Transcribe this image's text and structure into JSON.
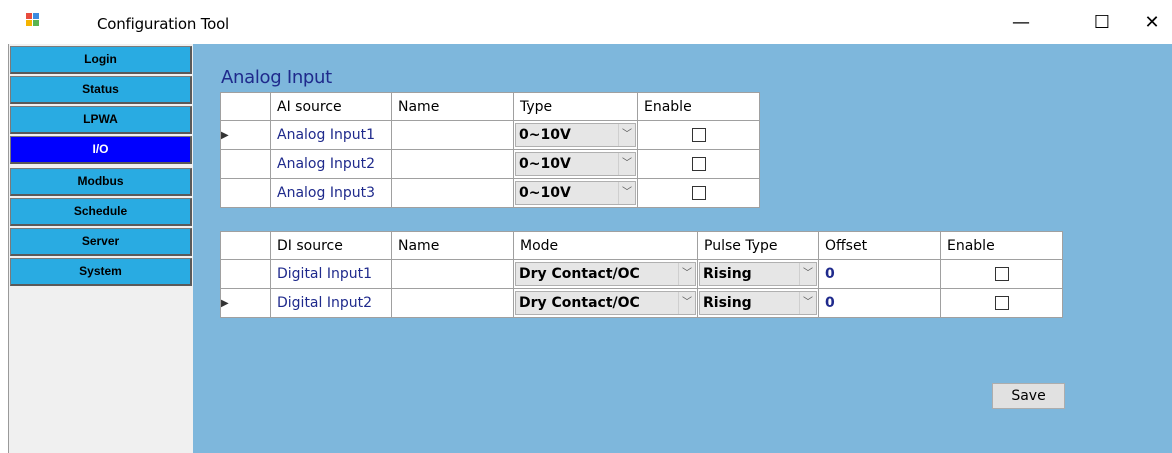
{
  "window": {
    "title": "Configuration Tool",
    "minimize": "—",
    "maximize": "☐",
    "close": "✕"
  },
  "sidebar": {
    "items": [
      {
        "label": "Login",
        "active": false
      },
      {
        "label": "Status",
        "active": false
      },
      {
        "label": "LPWA",
        "active": false
      },
      {
        "label": "I/O",
        "active": true
      },
      {
        "label": "Modbus",
        "active": false
      },
      {
        "label": "Schedule",
        "active": false
      },
      {
        "label": "Server",
        "active": false
      },
      {
        "label": "System",
        "active": false
      }
    ]
  },
  "analog": {
    "title": "Analog Input",
    "headers": [
      "AI source",
      "Name",
      "Type",
      "Enable"
    ],
    "rows": [
      {
        "source": "Analog Input1",
        "name": "",
        "type": "0~10V",
        "enabled": false,
        "selected": true
      },
      {
        "source": "Analog Input2",
        "name": "",
        "type": "0~10V",
        "enabled": false,
        "selected": false
      },
      {
        "source": "Analog Input3",
        "name": "",
        "type": "0~10V",
        "enabled": false,
        "selected": false
      }
    ]
  },
  "digital": {
    "headers": [
      "DI source",
      "Name",
      "Mode",
      "Pulse Type",
      "Offset",
      "Enable"
    ],
    "rows": [
      {
        "source": "Digital Input1",
        "name": "",
        "mode": "Dry Contact/OC",
        "pulse_type": "Rising",
        "offset": "0",
        "enabled": false,
        "selected": false
      },
      {
        "source": "Digital Input2",
        "name": "",
        "mode": "Dry Contact/OC",
        "pulse_type": "Rising",
        "offset": "0",
        "enabled": false,
        "selected": true
      }
    ]
  },
  "actions": {
    "save_label": "Save"
  },
  "icons": {
    "row_selector": "▶",
    "combo_arrow": "﹀"
  },
  "colors": {
    "panel_bg": "#7eb7dc",
    "nav_bg": "#29abe2",
    "nav_active_bg": "#0000ff",
    "link_text": "#1f2a8c"
  }
}
